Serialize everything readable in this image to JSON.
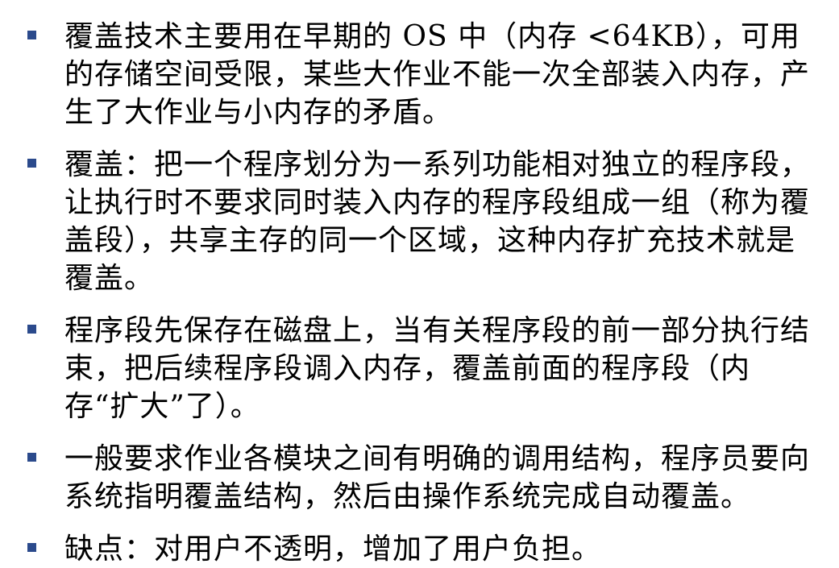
{
  "colors": {
    "bullet": "#2b4a8c",
    "text": "#000000",
    "background": "#ffffff"
  },
  "bullets": [
    {
      "text": "覆盖技术主要用在早期的 OS 中（内存 <64KB），可用的存储空间受限，某些大作业不能一次全部装入内存，产生了大作业与小内存的矛盾。"
    },
    {
      "text": "覆盖：把一个程序划分为一系列功能相对独立的程序段，让执行时不要求同时装入内存的程序段组成一组（称为覆盖段），共享主存的同一个区域，这种内存扩充技术就是覆盖。"
    },
    {
      "text": "程序段先保存在磁盘上，当有关程序段的前一部分执行结束，把后续程序段调入内存，覆盖前面的程序段（内存“扩大”了）。"
    },
    {
      "text": "一般要求作业各模块之间有明确的调用结构，程序员要向系统指明覆盖结构，然后由操作系统完成自动覆盖。"
    },
    {
      "text": "缺点：对用户不透明，增加了用户负担。"
    }
  ]
}
